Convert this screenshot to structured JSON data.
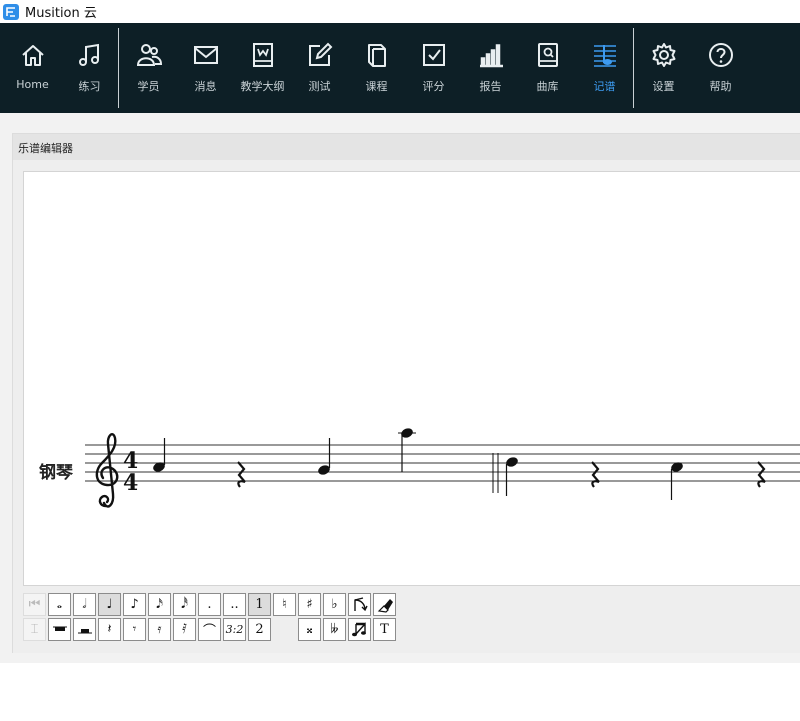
{
  "window": {
    "title": "Musition 云"
  },
  "nav": {
    "items": [
      {
        "id": "home",
        "label": "Home",
        "icon": "home-icon"
      },
      {
        "id": "practice",
        "label": "练习",
        "icon": "music-note-icon"
      },
      {
        "id": "students",
        "label": "学员",
        "icon": "users-icon"
      },
      {
        "id": "messages",
        "label": "消息",
        "icon": "mail-icon"
      },
      {
        "id": "syllabus",
        "label": "教学大纲",
        "icon": "syllabus-book-icon"
      },
      {
        "id": "tests",
        "label": "测试",
        "icon": "edit-icon"
      },
      {
        "id": "courses",
        "label": "课程",
        "icon": "book-icon"
      },
      {
        "id": "grading",
        "label": "评分",
        "icon": "checkbox-icon"
      },
      {
        "id": "reports",
        "label": "报告",
        "icon": "bar-chart-icon"
      },
      {
        "id": "library",
        "label": "曲库",
        "icon": "library-icon"
      },
      {
        "id": "notation",
        "label": "记谱",
        "icon": "notation-icon"
      },
      {
        "id": "settings",
        "label": "设置",
        "icon": "gear-icon"
      },
      {
        "id": "help",
        "label": "帮助",
        "icon": "help-icon"
      }
    ],
    "active": "notation",
    "active_color": "#3d9bf0"
  },
  "panel": {
    "title": "乐谱编辑器"
  },
  "score": {
    "instrument": "钢琴",
    "clef": "treble",
    "time_signature": {
      "top": "4",
      "bottom": "4"
    }
  },
  "toolbar": {
    "row1": [
      {
        "name": "prev-tool",
        "label": "⏮",
        "state": "disabled"
      },
      {
        "name": "whole-note",
        "label": "𝅝",
        "state": "normal"
      },
      {
        "name": "half-note",
        "label": "𝅗𝅥",
        "state": "normal"
      },
      {
        "name": "quarter-note",
        "label": "♩",
        "state": "selected"
      },
      {
        "name": "eighth-note",
        "label": "♪",
        "state": "normal"
      },
      {
        "name": "sixteenth-note",
        "label": "𝅘𝅥𝅯",
        "state": "normal"
      },
      {
        "name": "thirty-second-note",
        "label": "𝅘𝅥𝅰",
        "state": "normal"
      },
      {
        "name": "dot",
        "label": ".",
        "state": "normal"
      },
      {
        "name": "double-dot",
        "label": "..",
        "state": "normal"
      },
      {
        "name": "voice-1",
        "label": "1",
        "state": "selected"
      },
      {
        "name": "natural",
        "label": "♮",
        "state": "normal"
      },
      {
        "name": "sharp",
        "label": "♯",
        "state": "normal"
      },
      {
        "name": "flat",
        "label": "♭",
        "state": "normal"
      },
      {
        "name": "flip-stem",
        "label": "",
        "state": "normal"
      },
      {
        "name": "eraser",
        "label": "",
        "state": "normal"
      }
    ],
    "row2": [
      {
        "name": "extra-tool",
        "label": "⌶",
        "state": "disabled"
      },
      {
        "name": "whole-rest",
        "label": "",
        "state": "normal"
      },
      {
        "name": "half-rest",
        "label": "",
        "state": "normal"
      },
      {
        "name": "quarter-rest",
        "label": "𝄽",
        "state": "normal"
      },
      {
        "name": "eighth-rest",
        "label": "𝄾",
        "state": "normal"
      },
      {
        "name": "sixteenth-rest",
        "label": "𝄿",
        "state": "normal"
      },
      {
        "name": "thirty-second-rest",
        "label": "𝅀",
        "state": "normal"
      },
      {
        "name": "tie",
        "label": "⌒",
        "state": "normal"
      },
      {
        "name": "triplet",
        "label": "3:2",
        "state": "normal"
      },
      {
        "name": "voice-2",
        "label": "2",
        "state": "normal"
      },
      {
        "name": "double-sharp",
        "label": "𝄪",
        "state": "normal"
      },
      {
        "name": "double-flat",
        "label": "𝄫",
        "state": "normal"
      },
      {
        "name": "beam",
        "label": "",
        "state": "normal"
      },
      {
        "name": "text",
        "label": "T",
        "state": "normal"
      }
    ]
  }
}
